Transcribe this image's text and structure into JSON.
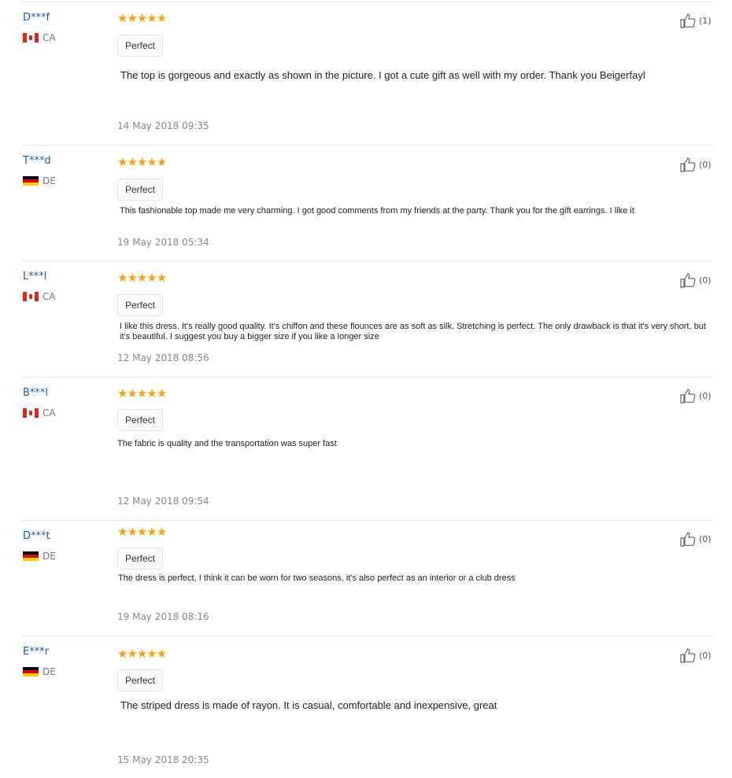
{
  "reviews": [
    {
      "user": "D***f",
      "country": "CA",
      "stars": "★★★★★",
      "label": "Perfect",
      "text": "The top is gorgeous and exactly as shown in the picture. I got a cute gift as well with my order. Thank you Beigerfayl",
      "date": "14 May 2018 09:35",
      "likes": "(1)"
    },
    {
      "user": "T***d",
      "country": "DE",
      "stars": "★★★★★",
      "label": "Perfect",
      "text": "This fashionable top made me very charming. I got good comments from my friends at the party. Thank you for the gift earrings. I like it",
      "date": "19 May 2018 05:34",
      "likes": "(0)"
    },
    {
      "user": "L***l",
      "country": "CA",
      "stars": "★★★★★",
      "label": "Perfect",
      "text": "I like this dress. It's really good quality. It's chiffon and these flounces are as soft as silk. Stretching is perfect. The only drawback is that it's very short, but it's beautiful. I suggest you buy a bigger size if you like a longer size",
      "date": "12 May 2018 08:56",
      "likes": "(0)"
    },
    {
      "user": "B***l",
      "country": "CA",
      "stars": "★★★★★",
      "label": "Perfect",
      "text": "The fabric is quality and the transportation was super fast",
      "date": "12 May 2018 09:54",
      "likes": "(0)"
    },
    {
      "user": "D***t",
      "country": "DE",
      "stars": "★★★★★",
      "label": "Perfect",
      "text": "The dress is perfect, I think it can be worn for two seasons, it's also perfect as an interior or a club dress",
      "date": "19 May 2018 08:16",
      "likes": "(0)"
    },
    {
      "user": "E***r",
      "country": "DE",
      "stars": "★★★★★",
      "label": "Perfect",
      "text": "The striped dress is made of rayon. It is casual, comfortable and inexpensive, great",
      "date": "15 May 2018 20:35",
      "likes": "(0)"
    }
  ],
  "colors": {
    "star": "#f4a213",
    "username": "#1f5aa6",
    "date": "#888888"
  }
}
